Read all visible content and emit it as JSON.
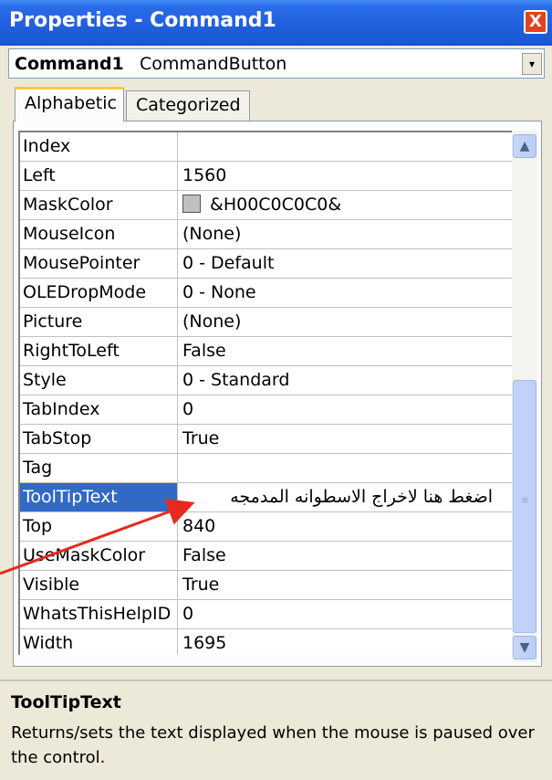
{
  "window": {
    "title": "Properties - Command1",
    "close_label": "X"
  },
  "object_selector": {
    "name": "Command1",
    "type": "CommandButton",
    "dropdown_label": "▾"
  },
  "tabs": [
    {
      "label": "Alphabetic"
    },
    {
      "label": "Categorized"
    }
  ],
  "properties": [
    {
      "name": "Index",
      "value": ""
    },
    {
      "name": "Left",
      "value": "1560"
    },
    {
      "name": "MaskColor",
      "value": "&H00C0C0C0&",
      "swatch": "#c0c0c0"
    },
    {
      "name": "MouseIcon",
      "value": "(None)"
    },
    {
      "name": "MousePointer",
      "value": "0 - Default"
    },
    {
      "name": "OLEDropMode",
      "value": "0 - None"
    },
    {
      "name": "Picture",
      "value": "(None)"
    },
    {
      "name": "RightToLeft",
      "value": "False"
    },
    {
      "name": "Style",
      "value": "0 - Standard"
    },
    {
      "name": "TabIndex",
      "value": "0"
    },
    {
      "name": "TabStop",
      "value": "True"
    },
    {
      "name": "Tag",
      "value": ""
    },
    {
      "name": "ToolTipText",
      "value": "اضغط هنا لاخراج الاسطوانه المدمجه",
      "selected": true
    },
    {
      "name": "Top",
      "value": "840"
    },
    {
      "name": "UseMaskColor",
      "value": "False"
    },
    {
      "name": "Visible",
      "value": "True"
    },
    {
      "name": "WhatsThisHelpID",
      "value": "0"
    },
    {
      "name": "Width",
      "value": "1695"
    }
  ],
  "scrollbar": {
    "up_icon": "▲",
    "down_icon": "▼"
  },
  "description": {
    "title": "ToolTipText",
    "text": "Returns/sets the text displayed when the mouse is paused over the control."
  },
  "colors": {
    "titlebar": "#1f5fdc",
    "selection": "#316ac5",
    "annotation_arrow": "#e8291f"
  }
}
